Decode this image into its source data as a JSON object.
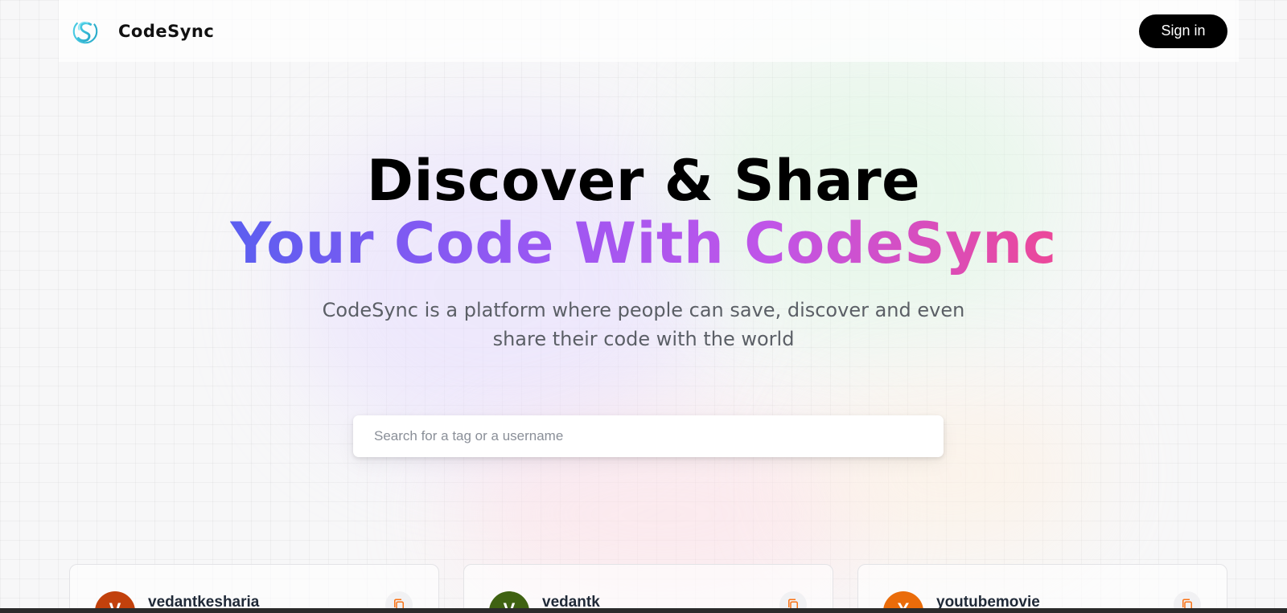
{
  "header": {
    "brand_name": "CodeSync",
    "signin_label": "Sign in"
  },
  "hero": {
    "title_line1": "Discover & Share",
    "title_line2": "Your Code With CodeSync",
    "subtitle": "CodeSync is a platform where people can save, discover and even share their code with the world"
  },
  "search": {
    "placeholder": "Search for a tag or a username",
    "value": ""
  },
  "cards": [
    {
      "avatar_letter": "V",
      "avatar_color": "#c2410c",
      "username": "vedantkesharia"
    },
    {
      "avatar_letter": "V",
      "avatar_color": "#3f6212",
      "username": "vedantk"
    },
    {
      "avatar_letter": "Y",
      "avatar_color": "#ea6c0a",
      "username": "youtubemovie"
    }
  ],
  "colors": {
    "gradient_start": "#5b5ef0",
    "gradient_mid": "#a855f7",
    "gradient_end": "#ec4899",
    "copy_icon": "#f97316"
  }
}
